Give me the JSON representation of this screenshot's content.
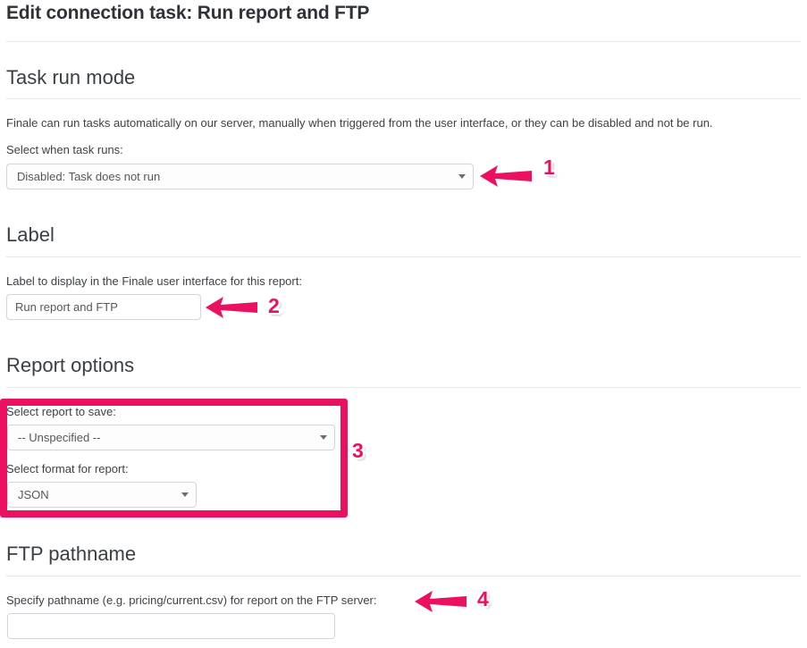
{
  "page": {
    "title": "Edit connection task: Run report and FTP"
  },
  "sections": {
    "task_run_mode": {
      "heading": "Task run mode",
      "description": "Finale can run tasks automatically on our server, manually when triggered from the user interface, or they can be disabled and not be run.",
      "select_label": "Select when task runs:",
      "select_value": "Disabled: Task does not run"
    },
    "label": {
      "heading": "Label",
      "field_label": "Label to display in the Finale user interface for this report:",
      "field_value": "Run report and FTP",
      "field_placeholder": ""
    },
    "report_options": {
      "heading": "Report options",
      "report_select_label": "Select report to save:",
      "report_select_value": "-- Unspecified --",
      "format_select_label": "Select format for report:",
      "format_select_value": "JSON"
    },
    "ftp_pathname": {
      "heading": "FTP pathname",
      "field_label": "Specify pathname (e.g. pricing/current.csv) for report on the FTP server:",
      "field_value": "",
      "field_placeholder": ""
    }
  },
  "annotations": {
    "color": "#EC1060",
    "callouts": [
      {
        "number": "1",
        "target": "task-run-mode-select"
      },
      {
        "number": "2",
        "target": "label-input"
      },
      {
        "number": "3",
        "target": "report-options-group"
      },
      {
        "number": "4",
        "target": "ftp-pathname-label"
      }
    ]
  }
}
